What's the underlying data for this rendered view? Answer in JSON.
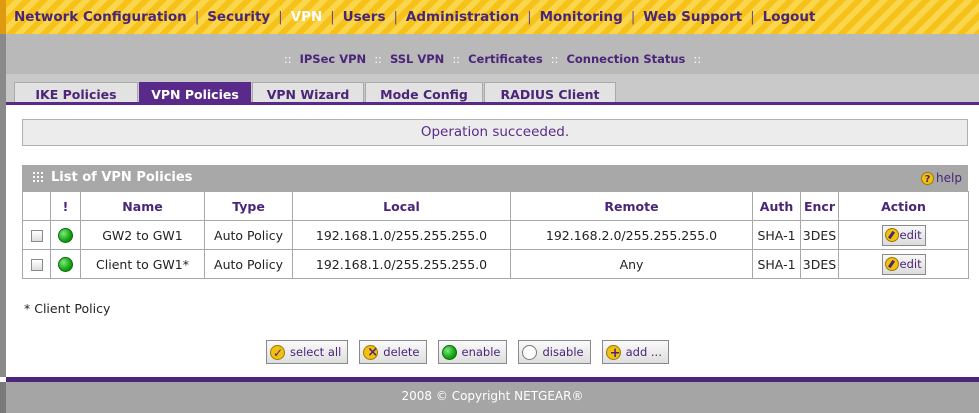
{
  "topnav": {
    "items": [
      {
        "label": "Network Configuration",
        "active": false
      },
      {
        "label": "Security",
        "active": false
      },
      {
        "label": "VPN",
        "active": true
      },
      {
        "label": "Users",
        "active": false
      },
      {
        "label": "Administration",
        "active": false
      },
      {
        "label": "Monitoring",
        "active": false
      },
      {
        "label": "Web Support",
        "active": false
      },
      {
        "label": "Logout",
        "active": false
      }
    ]
  },
  "subnav": {
    "items": [
      "IPSec VPN",
      "SSL VPN",
      "Certificates",
      "Connection Status"
    ],
    "separator": "::"
  },
  "tabs": [
    {
      "label": "IKE Policies",
      "active": false
    },
    {
      "label": "VPN Policies",
      "active": true
    },
    {
      "label": "VPN Wizard",
      "active": false
    },
    {
      "label": "Mode Config",
      "active": false
    },
    {
      "label": "RADIUS Client",
      "active": false
    }
  ],
  "status_message": "Operation succeeded.",
  "list": {
    "title": "List of VPN Policies",
    "help_label": "help",
    "columns": [
      "",
      "!",
      "Name",
      "Type",
      "Local",
      "Remote",
      "Auth",
      "Encr",
      "Action"
    ],
    "rows": [
      {
        "name": "GW2 to GW1",
        "type": "Auto Policy",
        "local": "192.168.1.0/255.255.255.0",
        "remote": "192.168.2.0/255.255.255.0",
        "auth": "SHA-1",
        "encr": "3DES",
        "action": "edit",
        "status_color": "#10a410"
      },
      {
        "name": "Client to GW1*",
        "type": "Auto Policy",
        "local": "192.168.1.0/255.255.255.0",
        "remote": "Any",
        "auth": "SHA-1",
        "encr": "3DES",
        "action": "edit",
        "status_color": "#10a410"
      }
    ]
  },
  "footnote": "* Client Policy",
  "buttons": {
    "select_all": "select all",
    "delete": "delete",
    "enable": "enable",
    "disable": "disable",
    "add": "add ..."
  },
  "footer": {
    "copyright": "2008 © Copyright NETGEAR®"
  },
  "colors": {
    "brand_purple": "#4a2578",
    "nav_yellow": "#f6c21a",
    "active_tab": "#5a2a8a",
    "status_green": "#10a410"
  }
}
